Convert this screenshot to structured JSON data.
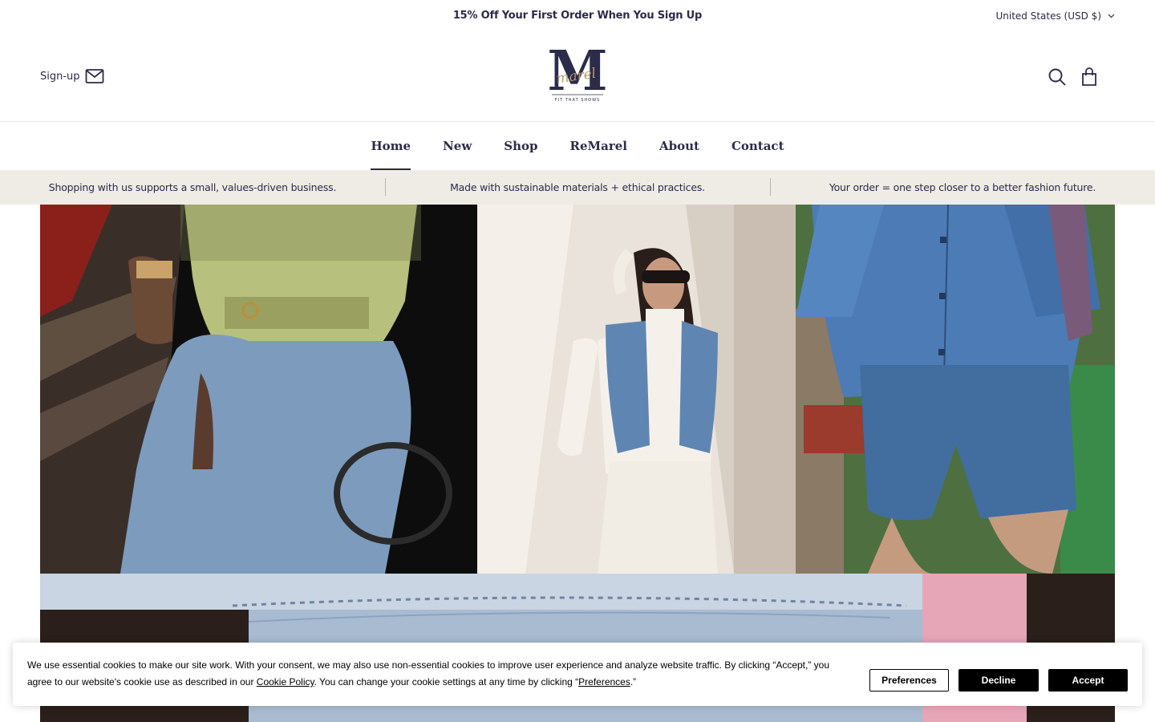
{
  "announcement": {
    "text": "15% Off Your First Order When You Sign Up",
    "currency": "United States (USD $)"
  },
  "header": {
    "signup_label": "Sign-up",
    "logo_letter": "M",
    "logo_script": "marel",
    "logo_tagline": "FIT THAT SHOWS"
  },
  "nav": {
    "items": [
      {
        "label": "Home"
      },
      {
        "label": "New"
      },
      {
        "label": "Shop"
      },
      {
        "label": "ReMarel"
      },
      {
        "label": "About"
      },
      {
        "label": "Contact"
      }
    ]
  },
  "values": [
    "Shopping with us supports a small, values-driven business.",
    "Made with sustainable materials + ethical practices.",
    "Your order = one step closer to a better fashion future."
  ],
  "cookie": {
    "text_1": "We use essential cookies to make our site work. With your consent, we may also use non-essential cookies to improve user experience and analyze website traffic. By clicking “Accept,” you agree to our website's cookie use as described in our ",
    "policy_link": "Cookie Policy",
    "text_2": ". You can change your cookie settings at any time by clicking “",
    "pref_link": "Preferences",
    "text_3": ".”",
    "preferences_label": "Preferences",
    "decline_label": "Decline",
    "accept_label": "Accept"
  },
  "colors": {
    "brand_navy": "#2b2b4a",
    "value_bar_bg": "#efece6",
    "logo_gold": "#b89a6e"
  },
  "icons": [
    "mail-icon",
    "search-icon",
    "bag-icon",
    "chevron-down-icon"
  ]
}
